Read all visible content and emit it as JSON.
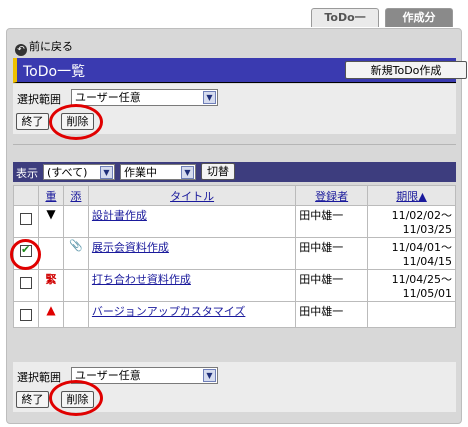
{
  "tabs": {
    "todo_list": "ToDo一覧",
    "created": "作成分"
  },
  "back_link": "前に戻る",
  "header": {
    "title": "ToDo一覧",
    "new_button": "新規ToDo作成"
  },
  "top_filter": {
    "range_label": "選択範囲",
    "range_value": "ユーザー任意",
    "end_button": "終了",
    "delete_button": "削除"
  },
  "list_filter": {
    "show_label": "表示",
    "show_value": "(すべて)",
    "status_value": "作業中",
    "switch_button": "切替"
  },
  "table": {
    "headers": {
      "importance": "重",
      "attach": "添",
      "title": "タイトル",
      "registrant": "登録者",
      "deadline": "期限▲"
    },
    "rows": [
      {
        "checked": false,
        "mark": "▼",
        "attach": "",
        "title": "設計書作成",
        "registrant": "田中雄一",
        "deadline": "11/02/02〜\n11/03/25"
      },
      {
        "checked": true,
        "mark": "",
        "attach": "📎",
        "title": "展示会資料作成",
        "registrant": "田中雄一",
        "deadline": "11/04/01〜\n11/04/15"
      },
      {
        "checked": false,
        "mark": "緊",
        "attach": "",
        "title": "打ち合わせ資料作成",
        "registrant": "田中雄一",
        "deadline": "11/04/25〜\n11/05/01"
      },
      {
        "checked": false,
        "mark": "▲",
        "attach": "",
        "title": "バージョンアップカスタマイズ",
        "registrant": "田中雄一",
        "deadline": ""
      }
    ]
  },
  "bottom_filter": {
    "range_label": "選択範囲",
    "range_value": "ユーザー任意",
    "end_button": "終了",
    "delete_button": "削除"
  },
  "colors": {
    "titlebar": "#3a3ab0",
    "titlebar_accent": "#f0c000",
    "highlight_circle": "#e00000",
    "link": "#1a1a9c"
  }
}
